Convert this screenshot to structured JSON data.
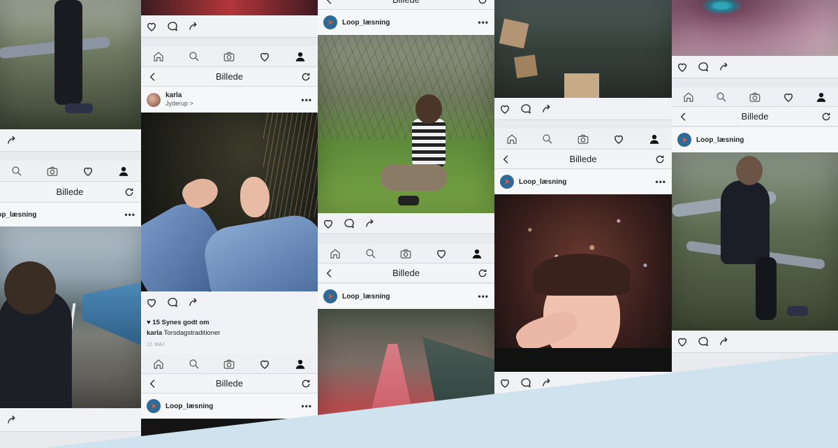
{
  "app": {
    "nav_title": "Billede",
    "account_name": "Loop_læsning",
    "menu_dots": "•••"
  },
  "post_karla": {
    "username": "karla",
    "location": "Jyderup >",
    "likes": "♥ 15 Synes godt om",
    "caption_user": "karla",
    "caption_text": "Torsdagstraditioner",
    "date": "12. MAJ"
  },
  "icons": [
    "heart-icon",
    "comment-icon",
    "share-icon",
    "home-icon",
    "search-icon",
    "camera-icon",
    "profile-icon",
    "back-chevron-icon",
    "refresh-icon"
  ],
  "colors": {
    "accent": "#2f6a96",
    "wave": "#cfe3ef",
    "ui_bg": "#f1f2f5"
  }
}
